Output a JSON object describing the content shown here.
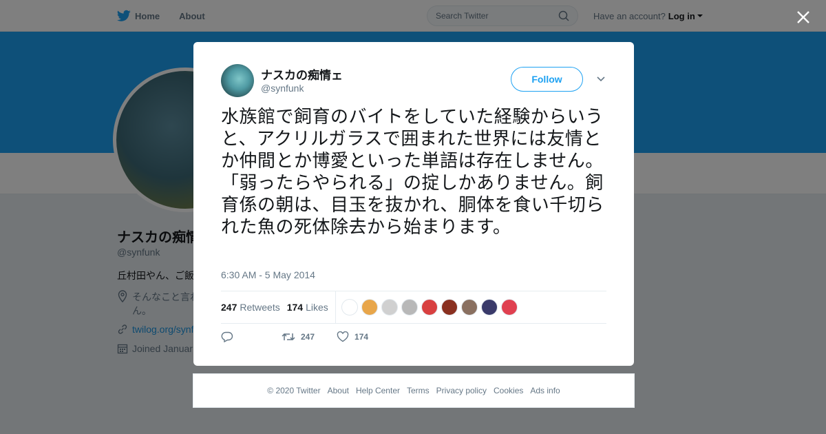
{
  "nav": {
    "home": "Home",
    "about": "About",
    "search_placeholder": "Search Twitter",
    "have_account": "Have an account?",
    "login": "Log in"
  },
  "profile": {
    "name": "ナスカの痴情ェ",
    "handle": "@synfunk",
    "bio": "丘村田やん、ご飯",
    "location": "そんなこと言わ",
    "location_line2": "ん。",
    "link": "twilog.org/synf",
    "joined": "Joined Januar"
  },
  "tweet": {
    "author_name": "ナスカの痴情ェ",
    "author_handle": "@synfunk",
    "follow_label": "Follow",
    "text": "水族館で飼育のバイトをしていた経験からいうと、アクリルガラスで囲まれた世界には友情とか仲間とか博愛といった単語は存在しません。「弱ったらやられる」の掟しかありません。飼育係の朝は、目玉を抜かれ、胴体を食い千切られた魚の死体除去から始まります。",
    "timestamp": "6:30 AM - 5 May 2014",
    "retweets_count": "247",
    "retweets_label": "Retweets",
    "likes_count": "174",
    "likes_label": "Likes",
    "liker_colors": [
      "#ffffff",
      "#e8a64a",
      "#d0d0d0",
      "#b8b8b8",
      "#d84040",
      "#8a3020",
      "#8a7060",
      "#3a3a6a",
      "#e04050"
    ],
    "action_retweets": "247",
    "action_likes": "174"
  },
  "footer": {
    "copyright": "© 2020 Twitter",
    "about": "About",
    "help": "Help Center",
    "terms": "Terms",
    "privacy": "Privacy policy",
    "cookies": "Cookies",
    "ads": "Ads info"
  },
  "colors": {
    "brand": "#1da1f2",
    "link": "#1b95e0"
  }
}
